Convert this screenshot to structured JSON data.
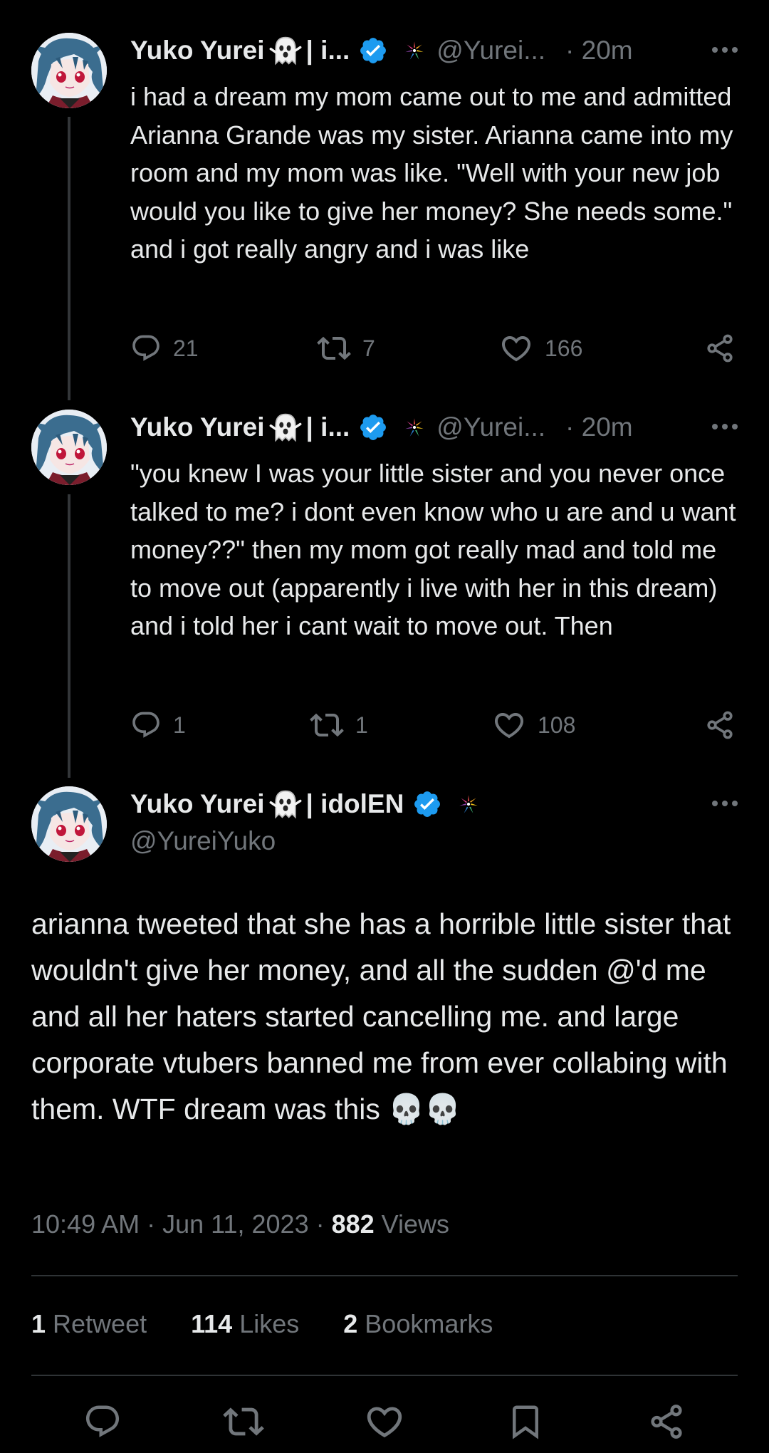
{
  "colors": {
    "background": "#000000",
    "text": "#e7e9ea",
    "muted": "#71767b",
    "verified": "#1d9bf0",
    "divider": "#2f3336"
  },
  "tweets": [
    {
      "name": "Yuko Yurei",
      "name_suffix": "| i...",
      "handle": "@Yurei...",
      "time": "· 20m",
      "text": "i had a dream my mom came out to me and admitted Arianna Grande was my sister. Arianna came into my room and my mom was like. \"Well with your new job would you like to give her money? She needs some.\" and i got really angry and i was like",
      "replies": "21",
      "retweets": "7",
      "likes": "166"
    },
    {
      "name": "Yuko Yurei",
      "name_suffix": "| i...",
      "handle": "@Yurei...",
      "time": "· 20m",
      "text": "\"you knew I was your little sister and you never once talked to me? i dont even know who u are and u want money??\" then my mom got really mad and told me to move out (apparently i live with her in this dream) and i told her i cant wait to move out. Then",
      "replies": "1",
      "retweets": "1",
      "likes": "108"
    }
  ],
  "main": {
    "name": "Yuko Yurei",
    "name_suffix": "| idolEN",
    "handle": "@YureiYuko",
    "text": "arianna tweeted that she has a horrible little sister that wouldn't give her money, and all the sudden @'d me and all her haters started cancelling me. and large corporate vtubers banned me from ever collabing with them. WTF dream was this 💀💀",
    "time": "10:49 AM · Jun 11, 2023 · ",
    "views_count": "882",
    "views_label": " Views",
    "retweets_count": "1",
    "retweets_label": " Retweet",
    "likes_count": "114",
    "likes_label": " Likes",
    "bookmarks_count": "2",
    "bookmarks_label": " Bookmarks"
  }
}
